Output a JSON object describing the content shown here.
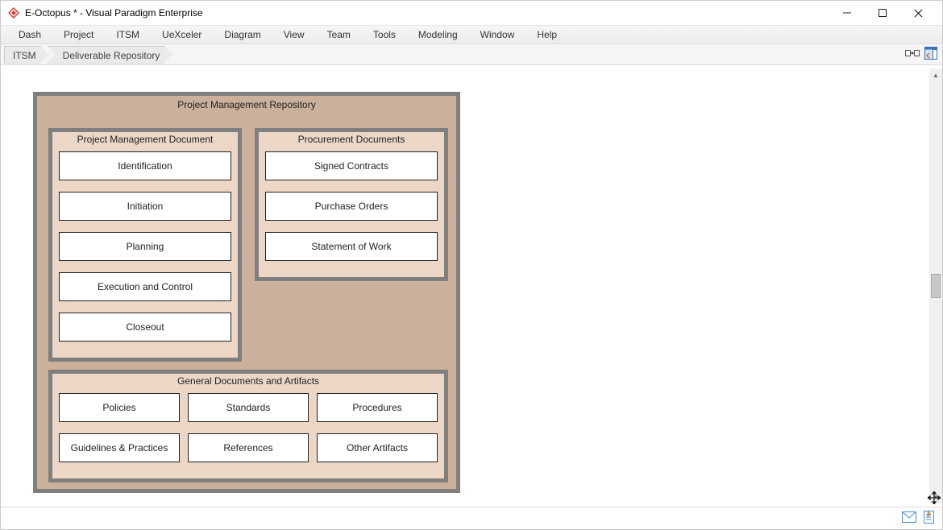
{
  "window": {
    "title": "E-Octopus * - Visual Paradigm Enterprise"
  },
  "menu": {
    "items": [
      "Dash",
      "Project",
      "ITSM",
      "UeXceler",
      "Diagram",
      "View",
      "Team",
      "Tools",
      "Modeling",
      "Window",
      "Help"
    ]
  },
  "breadcrumb": {
    "seg0": "ITSM",
    "seg1": "Deliverable Repository"
  },
  "diagram": {
    "repository_title": "Project Management Repository",
    "pm_doc_title": "Project Management Document",
    "pm_doc": {
      "b0": "Identification",
      "b1": "Initiation",
      "b2": "Planning",
      "b3": "Execution and Control",
      "b4": "Closeout"
    },
    "proc_title": "Procurement Documents",
    "proc": {
      "b0": "Signed Contracts",
      "b1": "Purchase Orders",
      "b2": "Statement of Work"
    },
    "gen_title": "General Documents and Artifacts",
    "gen": {
      "b0": "Policies",
      "b1": "Standards",
      "b2": "Procedures",
      "b3": "Guidelines & Practices",
      "b4": "References",
      "b5": "Other Artifacts"
    }
  }
}
